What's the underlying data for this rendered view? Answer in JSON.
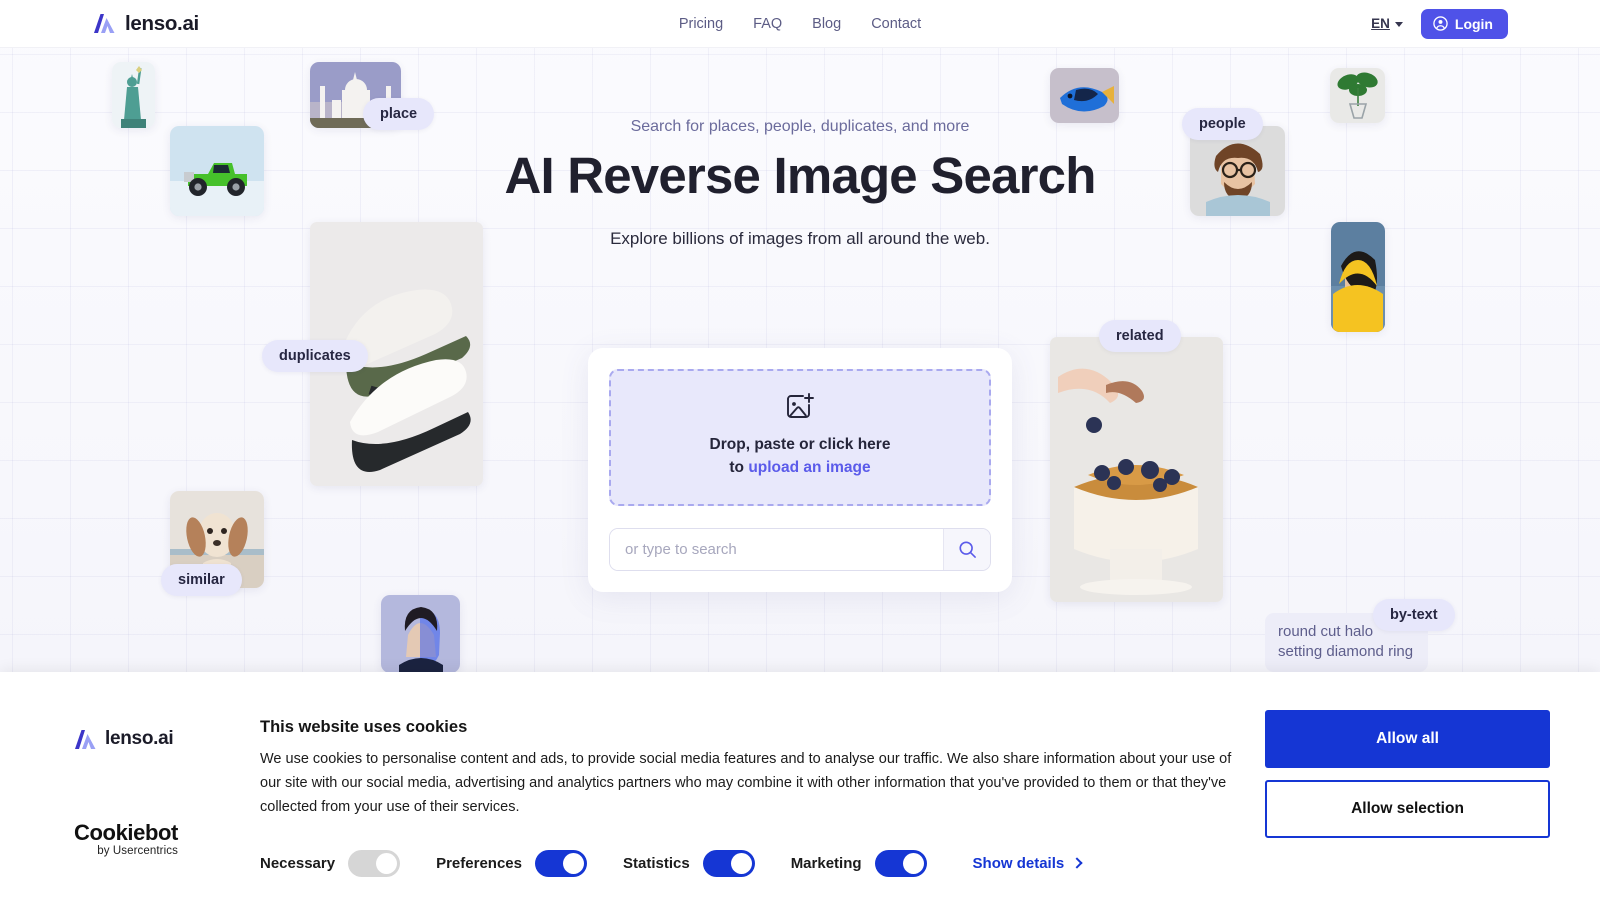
{
  "header": {
    "brand": "lenso.ai",
    "brand_icon": "lenso-logo-icon",
    "nav": [
      {
        "label": "Pricing"
      },
      {
        "label": "FAQ"
      },
      {
        "label": "Blog"
      },
      {
        "label": "Contact"
      }
    ],
    "language": {
      "label": "EN",
      "chevron_icon": "chevron-down-icon"
    },
    "login": {
      "label": "Login",
      "icon": "user-circle-icon",
      "color": "#4f52e8"
    }
  },
  "hero": {
    "eyebrow": "Search for places, people, duplicates, and more",
    "title": "AI Reverse Image Search",
    "subtitle": "Explore billions of images from all around the web."
  },
  "search_card": {
    "dropzone": {
      "icon": "image-plus-icon",
      "line1": "Drop, paste or click here",
      "line2_prefix": "to ",
      "line2_link": "upload an image"
    },
    "input": {
      "value": "",
      "placeholder": "or type to search"
    },
    "submit": {
      "icon": "search-icon",
      "label": ""
    }
  },
  "tags": [
    {
      "label": "place"
    },
    {
      "label": "duplicates"
    },
    {
      "label": "similar"
    },
    {
      "label": "people"
    },
    {
      "label": "related"
    },
    {
      "label": "by-text"
    }
  ],
  "text_card": {
    "text": "round cut halo setting diamond ring"
  },
  "thumbnails": [
    {
      "name": "statue-of-liberty"
    },
    {
      "name": "green-pickup-truck"
    },
    {
      "name": "taj-mahal"
    },
    {
      "name": "sneakers"
    },
    {
      "name": "dog-portrait"
    },
    {
      "name": "face-scan-portrait"
    },
    {
      "name": "blue-tang-fish"
    },
    {
      "name": "bearded-man-glasses"
    },
    {
      "name": "plant-in-vase"
    },
    {
      "name": "woman-yellow-hood"
    },
    {
      "name": "blueberry-cake"
    }
  ],
  "cookie_banner": {
    "brand": "lenso.ai",
    "provider": {
      "name": "Cookiebot",
      "byline": "by Usercentrics"
    },
    "title": "This website uses cookies",
    "body": "We use cookies to personalise content and ads, to provide social media features and to analyse our traffic. We also share information about your use of our site with our social media, advertising and analytics partners who may combine it with other information that you've provided to them or that they've collected from your use of their services.",
    "categories": [
      {
        "label": "Necessary",
        "state": "locked-on"
      },
      {
        "label": "Preferences",
        "state": "on"
      },
      {
        "label": "Statistics",
        "state": "on"
      },
      {
        "label": "Marketing",
        "state": "on"
      }
    ],
    "show_details": {
      "label": "Show details",
      "icon": "chevron-right-icon"
    },
    "buttons": {
      "allow_all": "Allow all",
      "allow_selection": "Allow selection"
    },
    "accent_color": "#1536d4"
  }
}
